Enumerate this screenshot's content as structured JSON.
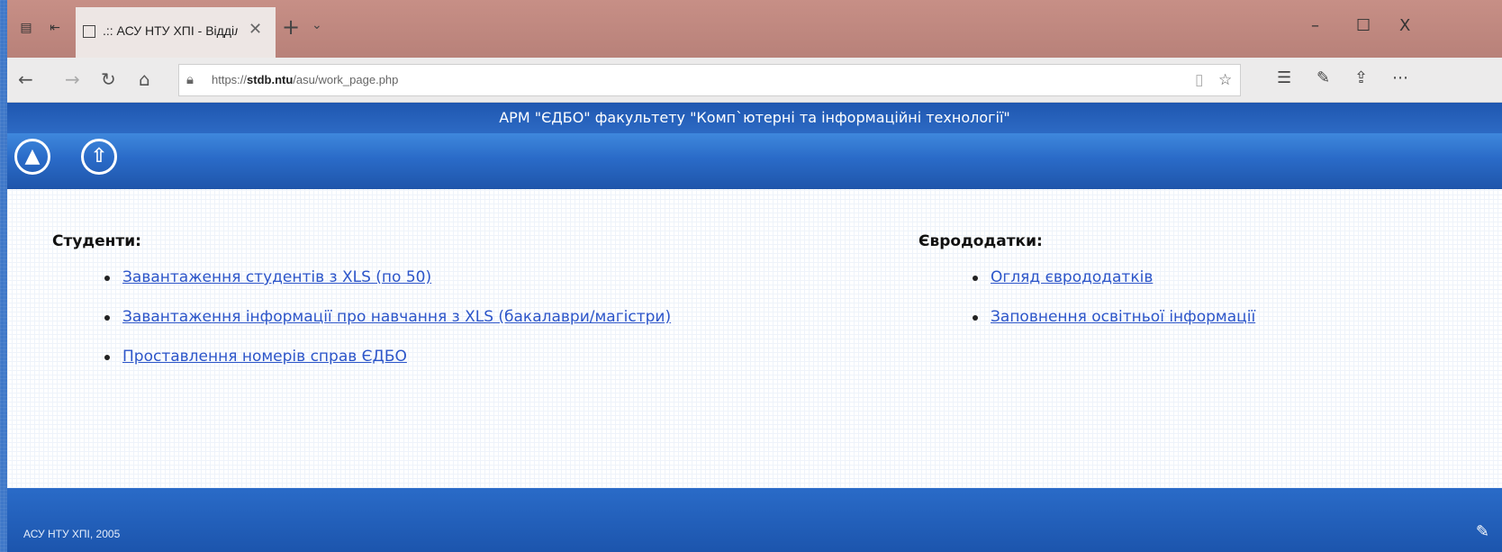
{
  "browser": {
    "tab_title": ".:: АСУ НТУ ХПІ - Відділ",
    "tab_close": "✕",
    "new_tab": "+",
    "tab_list": "⌄",
    "window_minimize": "–",
    "window_maximize": "☐",
    "window_close": "X",
    "url_prefix": "https://",
    "url_host": "stdb.ntu",
    "url_path": "/asu/work_page.php",
    "icons": [
      "tab-preview-icon",
      "tab-aside-icon",
      "back-icon",
      "forward-icon",
      "refresh-icon",
      "home-icon",
      "lock-icon",
      "reading-view-icon",
      "favorite-star-icon",
      "favorites-hub-icon",
      "pen-icon",
      "share-icon",
      "more-icon"
    ]
  },
  "site": {
    "title": "АРМ \"ЄДБО\" факультету \"Комп`ютерні та інформаційні технології\"",
    "toolbar_icons": [
      "logo-icon",
      "up-arrow-icon"
    ]
  },
  "students": {
    "heading": "Студенти:",
    "links": [
      "Завантаження студентів з XLS (по 50)",
      "Завантаження інформації про навчання з XLS (бакалаври/магістри)",
      "Проставлення номерів справ ЄДБО"
    ]
  },
  "eurosupplements": {
    "heading": "Єврододатки:",
    "links": [
      "Огляд єврододатків",
      "Заповнення освітньої інформації"
    ]
  },
  "footer": {
    "text": "АСУ НТУ ХПІ, 2005"
  },
  "colors": {
    "link": "#2c55c9",
    "header_blue": "#1f57b0",
    "tab_bar": "#c78f86"
  }
}
